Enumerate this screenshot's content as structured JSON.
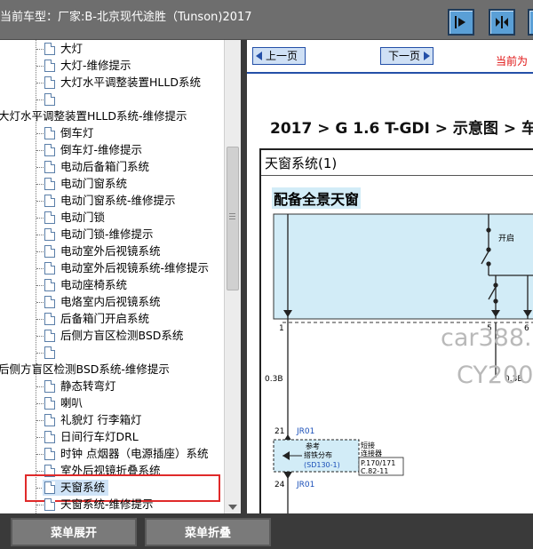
{
  "title_bar": {
    "title": "当前车型：厂家:B-北京现代途胜（Tunson)2017",
    "buttons": [
      "nav-next-icon",
      "collapse-panels-icon",
      "expand-panels-icon"
    ]
  },
  "tree": {
    "items": [
      {
        "label": "大灯",
        "indent": 2
      },
      {
        "label": "大灯-维修提示",
        "indent": 2
      },
      {
        "label": "大灯水平调整装置HLLD系统",
        "indent": 2
      },
      {
        "label": "",
        "indent": 2
      },
      {
        "label": "大灯水平调整装置HLLD系统-维修提示",
        "indent": 0
      },
      {
        "label": "倒车灯",
        "indent": 2
      },
      {
        "label": "倒车灯-维修提示",
        "indent": 2
      },
      {
        "label": "电动后备箱门系统",
        "indent": 2
      },
      {
        "label": "电动门窗系统",
        "indent": 2
      },
      {
        "label": "电动门窗系统-维修提示",
        "indent": 2
      },
      {
        "label": "电动门锁",
        "indent": 2
      },
      {
        "label": "电动门锁-维修提示",
        "indent": 2
      },
      {
        "label": "电动室外后视镜系统",
        "indent": 2
      },
      {
        "label": "电动室外后视镜系统-维修提示",
        "indent": 2
      },
      {
        "label": "电动座椅系统",
        "indent": 2
      },
      {
        "label": "电烙室内后视镜系统",
        "indent": 2
      },
      {
        "label": "后备箱门开启系统",
        "indent": 2
      },
      {
        "label": "后侧方盲区检测BSD系统",
        "indent": 2
      },
      {
        "label": "",
        "indent": 2
      },
      {
        "label": "后侧方盲区检测BSD系统-维修提示",
        "indent": 0
      },
      {
        "label": "静态转弯灯",
        "indent": 2
      },
      {
        "label": "喇叭",
        "indent": 2
      },
      {
        "label": "礼貌灯 行李箱灯",
        "indent": 2
      },
      {
        "label": "日间行车灯DRL",
        "indent": 2
      },
      {
        "label": "时钟 点烟器（电源插座）系统",
        "indent": 2
      },
      {
        "label": "室外后视镜折叠系统",
        "indent": 2
      },
      {
        "label": "天窗系统",
        "indent": 2,
        "selected": true
      },
      {
        "label": "天窗系统-维修提示",
        "indent": 2
      }
    ]
  },
  "doc": {
    "prev_label": "上一页",
    "next_label": "下一页",
    "current_page": "当前为",
    "breadcrumb": "2017 > G 1.6 T-GDI > 示意图 > 车",
    "diagram_title": "天窗系统(1)",
    "diagram_subtitle": "配备全景天窗",
    "switch_label": "开启",
    "pins": [
      "1",
      "5",
      "6"
    ],
    "wire_labels": [
      "0.3B",
      "0.3B"
    ],
    "connector_top": "21",
    "connector_top_id": "JR01",
    "connector_bottom": "24",
    "connector_bottom_id": "JR01",
    "ref_label_1": "参考",
    "ref_label_2": "搭铁分布",
    "ref_label_3": "(SD130-1)",
    "short_connector_1": "短接",
    "short_connector_2": "连接器",
    "page_ref_1": "P.170/171",
    "page_ref_2": "C.82-11",
    "watermark_1": "car388.",
    "watermark_2": "CY200"
  },
  "bottom_menu": {
    "expand_label": "菜单展开",
    "collapse_label": "菜单折叠"
  },
  "colors": {
    "title_bar_bg": "#6e6e6e",
    "accent_blue": "#2450a8",
    "highlight_red": "#e02a2a",
    "diagram_fill": "#d2ecf7"
  }
}
